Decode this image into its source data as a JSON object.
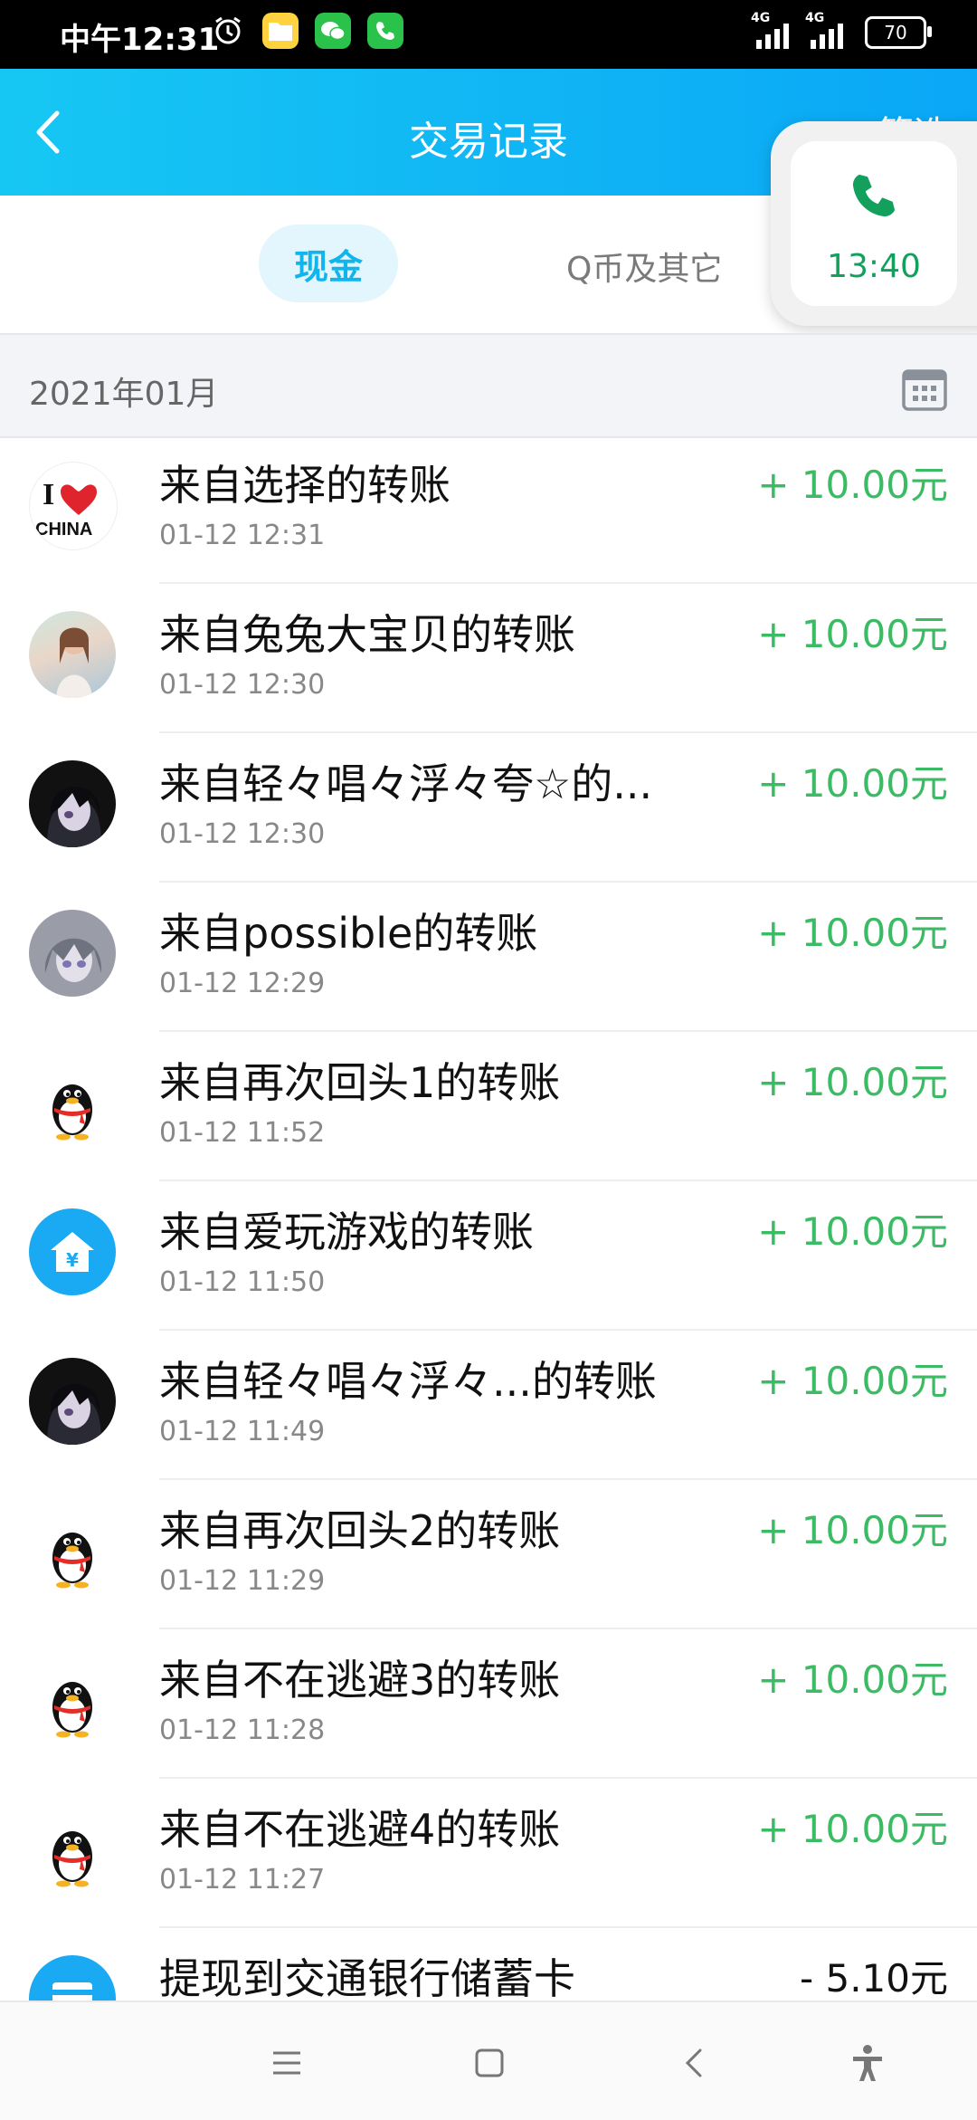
{
  "status_bar": {
    "time": "中午12:31",
    "network1": "4G",
    "network2": "4G",
    "battery": "70",
    "icons": [
      "alarm-icon",
      "folder-app-icon",
      "wechat-icon",
      "phone-app-icon"
    ]
  },
  "header": {
    "title": "交易记录",
    "filter_label": "筛选",
    "back_icon": "chevron-left-icon"
  },
  "tabs": [
    {
      "label": "现金",
      "active": true
    },
    {
      "label": "Q币及其它",
      "active": false
    }
  ],
  "call_bubble": {
    "time": "13:40",
    "icon": "phone-icon",
    "color": "#12a05c"
  },
  "month": {
    "label": "2021年01月",
    "icon": "calendar-icon"
  },
  "transactions": [
    {
      "title": "来自选择的转账",
      "time": "01-12 12:31",
      "amount": "+ 10.00元",
      "avatar": "i-love-china"
    },
    {
      "title": "来自兔兔大宝贝的转账",
      "time": "01-12 12:30",
      "amount": "+ 10.00元",
      "avatar": "photo"
    },
    {
      "title": "来自轻々唱々浮々夸☆的...",
      "time": "01-12 12:30",
      "amount": "+ 10.00元",
      "avatar": "anime-dark"
    },
    {
      "title": "来自possible的转账",
      "time": "01-12 12:29",
      "amount": "+ 10.00元",
      "avatar": "anime-grey"
    },
    {
      "title": "来自再次回头1的转账",
      "time": "01-12 11:52",
      "amount": "+ 10.00元",
      "avatar": "qq-penguin"
    },
    {
      "title": "来自爱玩游戏的转账",
      "time": "01-12 11:50",
      "amount": "+ 10.00元",
      "avatar": "yuan-house"
    },
    {
      "title": "来自轻々唱々浮々...的转账",
      "time": "01-12 11:49",
      "amount": "+ 10.00元",
      "avatar": "anime-dark"
    },
    {
      "title": "来自再次回头2的转账",
      "time": "01-12 11:29",
      "amount": "+ 10.00元",
      "avatar": "qq-penguin"
    },
    {
      "title": "来自不在逃避3的转账",
      "time": "01-12 11:28",
      "amount": "+ 10.00元",
      "avatar": "qq-penguin"
    },
    {
      "title": "来自不在逃避4的转账",
      "time": "01-12 11:27",
      "amount": "+ 10.00元",
      "avatar": "qq-penguin"
    },
    {
      "title": "提现到交通银行储蓄卡",
      "time": "",
      "amount": "- 5.10元",
      "avatar": "bank-card"
    }
  ],
  "colors": {
    "header_gradient_start": "#17c7f3",
    "header_gradient_end": "#0aa7f6",
    "income": "#3bbb63",
    "tab_active": "#10b5ee"
  },
  "nav_bar": [
    "menu-icon",
    "home-square-icon",
    "back-triangle-icon",
    "accessibility-icon"
  ]
}
